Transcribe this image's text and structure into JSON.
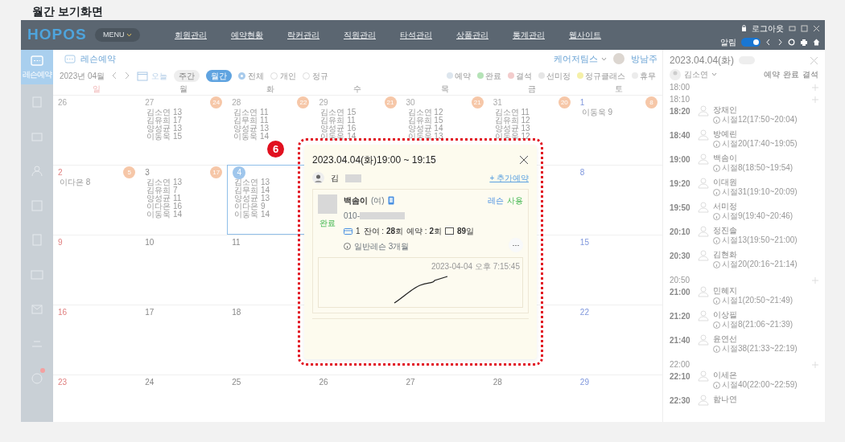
{
  "page_title": "월간 보기화면",
  "topbar": {
    "logo": "HOPOS",
    "menu_button": "MENU",
    "nav": [
      "회원관리",
      "예약현황",
      "락커관리",
      "직원관리",
      "타석관리",
      "상품관리",
      "통계관리",
      "웹사이트"
    ],
    "logout": "로그아웃",
    "notify": {
      "label": "알림",
      "on": true
    }
  },
  "sidebar": [
    {
      "label": "레슨예약",
      "selected": true
    },
    {
      "selected": false
    },
    {
      "selected": false
    },
    {
      "selected": false
    },
    {
      "selected": false
    },
    {
      "selected": false
    },
    {
      "selected": false
    },
    {
      "selected": false
    },
    {
      "selected": false
    },
    {
      "selected": false,
      "alert": true
    }
  ],
  "header": {
    "title": "레슨예약",
    "team": "케어저팀스",
    "user": "방남주"
  },
  "toolbar": {
    "month": "2023년 04월",
    "today": "오늘",
    "views": [
      {
        "label": "주간",
        "selected": false
      },
      {
        "label": "월간",
        "selected": true
      }
    ],
    "filters": [
      {
        "label": "전체",
        "selected": true
      },
      {
        "label": "개인",
        "selected": false
      },
      {
        "label": "정규",
        "selected": false
      }
    ],
    "legend": [
      {
        "label": "예약",
        "color": "#dde6ee"
      },
      {
        "label": "완료",
        "color": "#b5e3b7"
      },
      {
        "label": "결석",
        "color": "#f3cccc"
      },
      {
        "label": "선미정",
        "color": "#e6e6e6"
      },
      {
        "label": "정규클래스",
        "color": "#f5f0a8"
      },
      {
        "label": "휴무",
        "color": "#ececec"
      }
    ]
  },
  "calendar": {
    "weekdays": [
      "일",
      "월",
      "화",
      "수",
      "목",
      "금",
      "토"
    ],
    "weeks": [
      {
        "left": [
          {
            "date": "26",
            "muted": true
          },
          {
            "date": "27",
            "muted": true,
            "badge": "24",
            "entries": [
              {
                "name": "김소연",
                "count": "13"
              },
              {
                "name": "김유희",
                "count": "17"
              },
              {
                "name": "양성균",
                "count": "13"
              },
              {
                "name": "이동욱",
                "count": "15"
              }
            ]
          },
          {
            "date": "28",
            "muted": true,
            "badge": "22",
            "entries": [
              {
                "name": "김소연",
                "count": "11"
              },
              {
                "name": "김무희",
                "count": "11"
              },
              {
                "name": "양성균",
                "count": "13"
              },
              {
                "name": "이동욱",
                "count": "14"
              }
            ]
          },
          {
            "date": "29",
            "muted": true,
            "badge": "21",
            "entries": [
              {
                "name": "김소연",
                "count": "15"
              },
              {
                "name": "김유희",
                "count": "11"
              },
              {
                "name": "양성균",
                "count": "16"
              },
              {
                "name": "이동욱",
                "count": "14"
              }
            ]
          },
          {
            "date": "30",
            "muted": true,
            "badge": "21",
            "entries": [
              {
                "name": "김소연",
                "count": "12"
              },
              {
                "name": "김유희",
                "count": "15"
              },
              {
                "name": "양성균",
                "count": "14"
              },
              {
                "name": "이동욱",
                "count": "13"
              }
            ]
          },
          {
            "date": "31",
            "muted": true,
            "badge": "20",
            "entries": [
              {
                "name": "김소연",
                "count": "11"
              },
              {
                "name": "김유희",
                "count": "12"
              },
              {
                "name": "양성균",
                "count": "13"
              },
              {
                "name": "이동욱",
                "count": "12"
              }
            ]
          },
          {
            "date": "1",
            "badge": "8",
            "entries": [
              {
                "name": "이동욱",
                "count": "9"
              }
            ]
          }
        ]
      },
      {
        "left": [
          {
            "date": "2",
            "badge": "5",
            "entries": [
              {
                "name": "이다은",
                "count": "8"
              }
            ]
          },
          {
            "date": "3",
            "badge": "17",
            "entries": [
              {
                "name": "김소연",
                "count": "13"
              },
              {
                "name": "김유희",
                "count": "7"
              },
              {
                "name": "양성균",
                "count": "11"
              },
              {
                "name": "이다은",
                "count": "16"
              },
              {
                "name": "이동욱",
                "count": "14"
              }
            ]
          },
          {
            "date": "4",
            "selected": true,
            "entries": [
              {
                "name": "김소연",
                "count": "13"
              },
              {
                "name": "김무희",
                "count": "14"
              },
              {
                "name": "양성균",
                "count": "13"
              },
              {
                "name": "이다은",
                "count": "9"
              },
              {
                "name": "이동욱",
                "count": "14"
              }
            ]
          }
        ],
        "right": [
          {
            "date": "8"
          }
        ]
      },
      {
        "left": [
          {
            "date": "9"
          },
          {
            "date": "10"
          },
          {
            "date": "11"
          }
        ],
        "right": [
          {
            "date": "15"
          }
        ]
      },
      {
        "left": [
          {
            "date": "16"
          },
          {
            "date": "17"
          },
          {
            "date": "18"
          }
        ],
        "right": [
          {
            "date": "22"
          }
        ]
      },
      {
        "left": [
          {
            "date": "23"
          },
          {
            "date": "24"
          },
          {
            "date": "25"
          },
          {
            "date": "26"
          },
          {
            "date": "27"
          },
          {
            "date": "28"
          },
          {
            "date": "29"
          }
        ]
      }
    ]
  },
  "day_panel": {
    "date": "2023.04.04(화)",
    "trainer": "김소연",
    "legend": [
      "예약",
      "완료",
      "결석"
    ],
    "slots": [
      {
        "kind": "open",
        "time": "18:00"
      },
      {
        "kind": "open",
        "time": "18:10"
      },
      {
        "kind": "booking",
        "time": "18:20",
        "name": "장채인",
        "detail": "시절12(17:50~20:04)"
      },
      {
        "kind": "booking",
        "time": "18:40",
        "name": "방예린",
        "detail": "시절20(17:40~19:05)"
      },
      {
        "kind": "booking",
        "time": "19:00",
        "name": "백솜이",
        "detail": "시절8(18:50~19:54)"
      },
      {
        "kind": "booking",
        "time": "19:20",
        "name": "이대원",
        "detail": "시절31(19:10~20:09)"
      },
      {
        "kind": "booking",
        "time": "19:50",
        "name": "서미정",
        "detail": "시절9(19:40~20:46)"
      },
      {
        "kind": "booking",
        "time": "20:10",
        "name": "정진솔",
        "detail": "시절13(19:50~21:00)"
      },
      {
        "kind": "booking",
        "time": "20:30",
        "name": "김현화",
        "detail": "시절20(20:16~21:14)"
      },
      {
        "kind": "open",
        "time": "20:50"
      },
      {
        "kind": "booking",
        "time": "21:00",
        "name": "민혜지",
        "detail": "시절1(20:50~21:49)"
      },
      {
        "kind": "booking",
        "time": "21:20",
        "name": "이상필",
        "detail": "시절8(21:06~21:39)"
      },
      {
        "kind": "booking",
        "time": "21:40",
        "name": "윤연선",
        "detail": "시절38(21:33~22:19)"
      },
      {
        "kind": "open",
        "time": "22:00"
      },
      {
        "kind": "booking",
        "time": "22:10",
        "name": "이세은",
        "detail": "시절40(22:00~22:59)"
      },
      {
        "kind": "booking",
        "time": "22:30",
        "name": "함나연"
      }
    ]
  },
  "popup": {
    "title": "2023.04.04(화)19:00 ~ 19:15",
    "trainer": "김",
    "add_button": "+ 추가예약",
    "annotation": "6",
    "member": {
      "name": "백솜이",
      "gender": "(여)",
      "phone": "010-",
      "status": "완료",
      "stats": [
        "1",
        "잔여 : **28**회",
        "예약 : **2**회",
        "**89**일"
      ],
      "product": "일반레슨 3개월",
      "tags": [
        {
          "label": "레슨",
          "kind": "lesson"
        },
        {
          "label": "사용",
          "kind": "usage"
        }
      ],
      "more_button": "···"
    },
    "signed_at": "2023-04-04 오후 7:15:45"
  }
}
